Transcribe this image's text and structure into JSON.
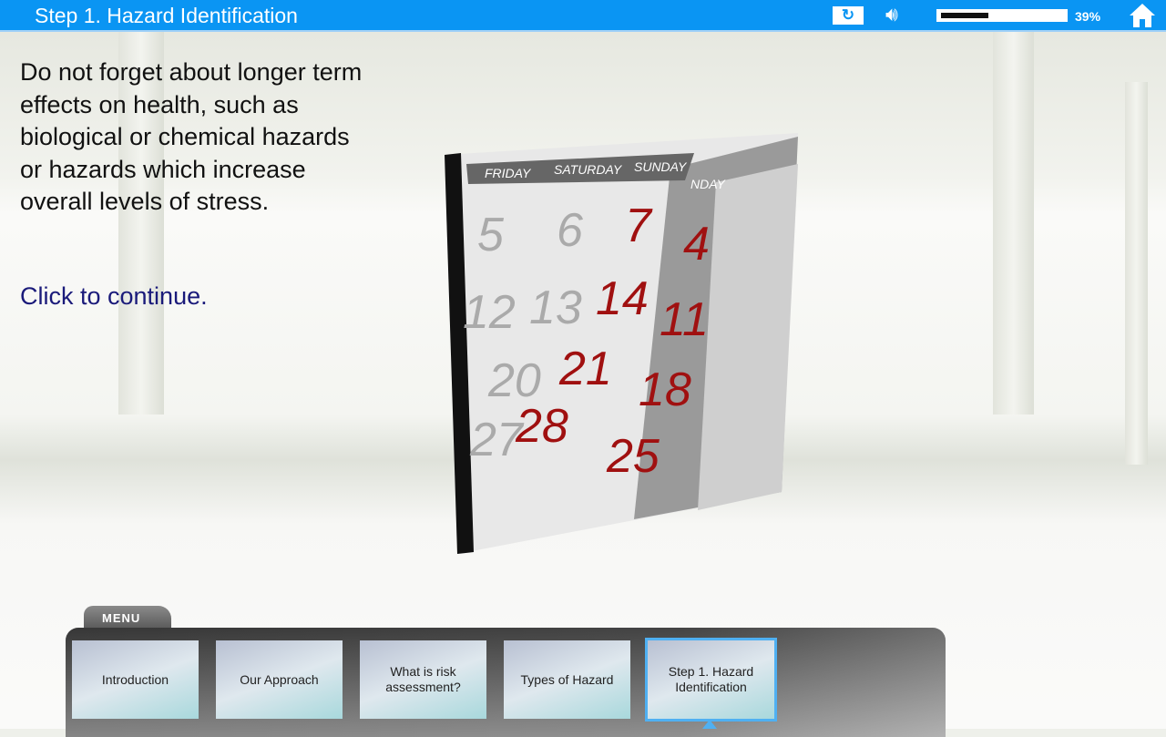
{
  "header": {
    "title": "Step 1. Hazard Identification",
    "replay_icon": "replay-icon",
    "sound_icon": "speaker-icon",
    "progress_percent": 39,
    "progress_label": "39%",
    "home_icon": "home-icon",
    "color": "#0a95f3"
  },
  "content": {
    "body": "Do not forget about longer term effects on health, such as biological or chemical hazards or hazards which increase overall levels of stress.",
    "continue": "Click to continue."
  },
  "calendar": {
    "days": [
      "FRIDAY",
      "SATURDAY",
      "SUNDAY"
    ],
    "rows": [
      [
        "5",
        "6",
        "7"
      ],
      [
        "12",
        "13",
        "14"
      ],
      [
        "20",
        "21"
      ],
      [
        "27",
        "28"
      ]
    ],
    "back": [
      "4",
      "11",
      "18",
      "25"
    ],
    "tab": "NDAY"
  },
  "menu": {
    "tab_label": "MENU",
    "items": [
      {
        "label": "Introduction"
      },
      {
        "label": "Our Approach"
      },
      {
        "label": "What is risk assessment?"
      },
      {
        "label": "Types of Hazard"
      },
      {
        "label": "Step 1. Hazard Identification",
        "active": true
      }
    ]
  }
}
